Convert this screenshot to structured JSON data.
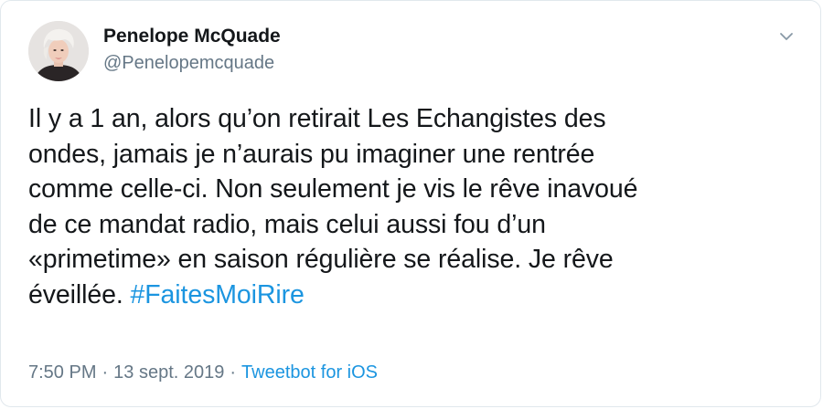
{
  "author": {
    "display_name": "Penelope McQuade",
    "handle": "@Penelopemcquade",
    "avatar_icon": "profile-photo-avatar"
  },
  "tweet": {
    "lines": [
      "Il y a 1 an, alors qu’on retirait Les Echangistes des",
      "ondes, jamais je n’aurais pu imaginer une rentrée",
      "comme celle-ci. Non seulement je vis le rêve inavoué",
      "de ce mandat radio, mais celui aussi fou d’un",
      "«primetime» en saison régulière se réalise. Je rêve",
      "éveillée."
    ],
    "hashtag": "#FaitesMoiRire"
  },
  "meta": {
    "time": "7:50 PM",
    "separator": "·",
    "date": "13 sept. 2019",
    "source": "Tweetbot for iOS"
  },
  "menu": {
    "icon": "chevron-down-icon"
  },
  "colors": {
    "text": "#14171a",
    "secondary": "#657786",
    "link": "#1b95e0",
    "border": "#e1e8ed"
  }
}
